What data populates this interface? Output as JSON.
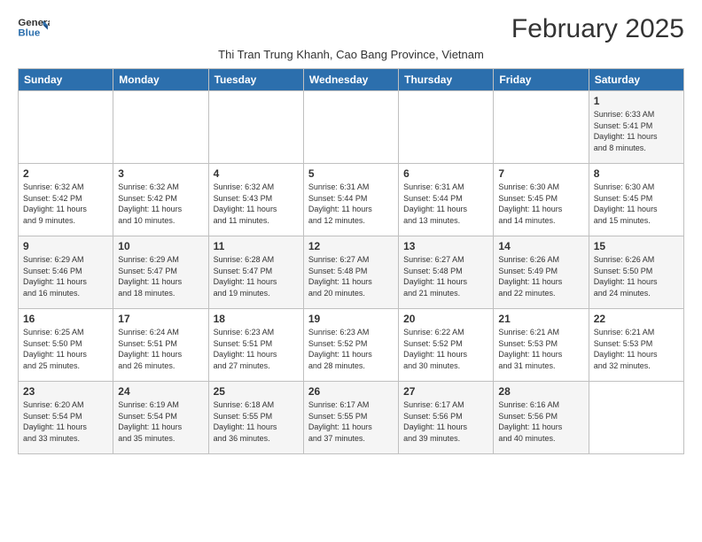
{
  "header": {
    "logo_line1": "General",
    "logo_line2": "Blue",
    "month_title": "February 2025",
    "subtitle": "Thi Tran Trung Khanh, Cao Bang Province, Vietnam"
  },
  "weekdays": [
    "Sunday",
    "Monday",
    "Tuesday",
    "Wednesday",
    "Thursday",
    "Friday",
    "Saturday"
  ],
  "weeks": [
    [
      {
        "day": "",
        "info": ""
      },
      {
        "day": "",
        "info": ""
      },
      {
        "day": "",
        "info": ""
      },
      {
        "day": "",
        "info": ""
      },
      {
        "day": "",
        "info": ""
      },
      {
        "day": "",
        "info": ""
      },
      {
        "day": "1",
        "info": "Sunrise: 6:33 AM\nSunset: 5:41 PM\nDaylight: 11 hours\nand 8 minutes."
      }
    ],
    [
      {
        "day": "2",
        "info": "Sunrise: 6:32 AM\nSunset: 5:42 PM\nDaylight: 11 hours\nand 9 minutes."
      },
      {
        "day": "3",
        "info": "Sunrise: 6:32 AM\nSunset: 5:42 PM\nDaylight: 11 hours\nand 10 minutes."
      },
      {
        "day": "4",
        "info": "Sunrise: 6:32 AM\nSunset: 5:43 PM\nDaylight: 11 hours\nand 11 minutes."
      },
      {
        "day": "5",
        "info": "Sunrise: 6:31 AM\nSunset: 5:44 PM\nDaylight: 11 hours\nand 12 minutes."
      },
      {
        "day": "6",
        "info": "Sunrise: 6:31 AM\nSunset: 5:44 PM\nDaylight: 11 hours\nand 13 minutes."
      },
      {
        "day": "7",
        "info": "Sunrise: 6:30 AM\nSunset: 5:45 PM\nDaylight: 11 hours\nand 14 minutes."
      },
      {
        "day": "8",
        "info": "Sunrise: 6:30 AM\nSunset: 5:45 PM\nDaylight: 11 hours\nand 15 minutes."
      }
    ],
    [
      {
        "day": "9",
        "info": "Sunrise: 6:29 AM\nSunset: 5:46 PM\nDaylight: 11 hours\nand 16 minutes."
      },
      {
        "day": "10",
        "info": "Sunrise: 6:29 AM\nSunset: 5:47 PM\nDaylight: 11 hours\nand 18 minutes."
      },
      {
        "day": "11",
        "info": "Sunrise: 6:28 AM\nSunset: 5:47 PM\nDaylight: 11 hours\nand 19 minutes."
      },
      {
        "day": "12",
        "info": "Sunrise: 6:27 AM\nSunset: 5:48 PM\nDaylight: 11 hours\nand 20 minutes."
      },
      {
        "day": "13",
        "info": "Sunrise: 6:27 AM\nSunset: 5:48 PM\nDaylight: 11 hours\nand 21 minutes."
      },
      {
        "day": "14",
        "info": "Sunrise: 6:26 AM\nSunset: 5:49 PM\nDaylight: 11 hours\nand 22 minutes."
      },
      {
        "day": "15",
        "info": "Sunrise: 6:26 AM\nSunset: 5:50 PM\nDaylight: 11 hours\nand 24 minutes."
      }
    ],
    [
      {
        "day": "16",
        "info": "Sunrise: 6:25 AM\nSunset: 5:50 PM\nDaylight: 11 hours\nand 25 minutes."
      },
      {
        "day": "17",
        "info": "Sunrise: 6:24 AM\nSunset: 5:51 PM\nDaylight: 11 hours\nand 26 minutes."
      },
      {
        "day": "18",
        "info": "Sunrise: 6:23 AM\nSunset: 5:51 PM\nDaylight: 11 hours\nand 27 minutes."
      },
      {
        "day": "19",
        "info": "Sunrise: 6:23 AM\nSunset: 5:52 PM\nDaylight: 11 hours\nand 28 minutes."
      },
      {
        "day": "20",
        "info": "Sunrise: 6:22 AM\nSunset: 5:52 PM\nDaylight: 11 hours\nand 30 minutes."
      },
      {
        "day": "21",
        "info": "Sunrise: 6:21 AM\nSunset: 5:53 PM\nDaylight: 11 hours\nand 31 minutes."
      },
      {
        "day": "22",
        "info": "Sunrise: 6:21 AM\nSunset: 5:53 PM\nDaylight: 11 hours\nand 32 minutes."
      }
    ],
    [
      {
        "day": "23",
        "info": "Sunrise: 6:20 AM\nSunset: 5:54 PM\nDaylight: 11 hours\nand 33 minutes."
      },
      {
        "day": "24",
        "info": "Sunrise: 6:19 AM\nSunset: 5:54 PM\nDaylight: 11 hours\nand 35 minutes."
      },
      {
        "day": "25",
        "info": "Sunrise: 6:18 AM\nSunset: 5:55 PM\nDaylight: 11 hours\nand 36 minutes."
      },
      {
        "day": "26",
        "info": "Sunrise: 6:17 AM\nSunset: 5:55 PM\nDaylight: 11 hours\nand 37 minutes."
      },
      {
        "day": "27",
        "info": "Sunrise: 6:17 AM\nSunset: 5:56 PM\nDaylight: 11 hours\nand 39 minutes."
      },
      {
        "day": "28",
        "info": "Sunrise: 6:16 AM\nSunset: 5:56 PM\nDaylight: 11 hours\nand 40 minutes."
      },
      {
        "day": "",
        "info": ""
      }
    ]
  ]
}
